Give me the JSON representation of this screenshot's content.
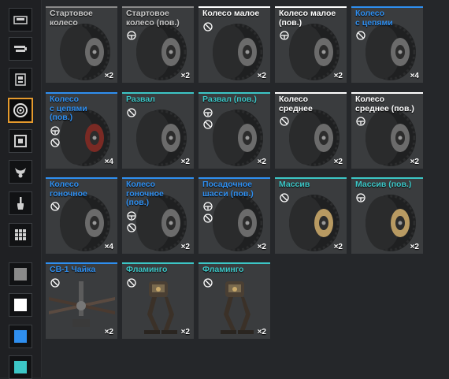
{
  "sidebar": {
    "categories": [
      {
        "icon": "cabin-icon",
        "active": false
      },
      {
        "icon": "weapons-icon",
        "active": false
      },
      {
        "icon": "modules-icon",
        "active": false
      },
      {
        "icon": "wheel-icon",
        "active": true
      },
      {
        "icon": "frame-icon",
        "active": false
      },
      {
        "icon": "decor-icon",
        "active": false
      },
      {
        "icon": "paint-brush-icon",
        "active": false
      },
      {
        "icon": "grid-icon",
        "active": false
      }
    ],
    "color_filters": [
      "#8a8a8a",
      "#ffffff",
      "#2f8ff0",
      "#3cc6c6"
    ]
  },
  "colors": {
    "common": "#8a8a8a",
    "rare": "#2f8ff0",
    "special": "#3cc6c6",
    "epic": "#ffffff"
  },
  "items": [
    {
      "name": "Стартовое колесо",
      "rarity": "common",
      "count": "×2",
      "perks": []
    },
    {
      "name": "Стартовое колесо (пов.)",
      "rarity": "common",
      "count": "×2",
      "perks": [
        "steer-icon"
      ]
    },
    {
      "name": "Колесо малое",
      "rarity": "epic",
      "count": "×2",
      "perks": [
        "no-steer-icon"
      ]
    },
    {
      "name": "Колесо малое (пов.)",
      "rarity": "epic",
      "count": "×2",
      "perks": [
        "steer-icon"
      ]
    },
    {
      "name": "Колесо с цепями",
      "rarity": "rare",
      "count": "×4",
      "perks": [
        "no-steer-icon"
      ]
    },
    {
      "name": "Колесо с цепями (пов.)",
      "rarity": "rare",
      "count": "×4",
      "perks": [
        "steer-icon",
        "no-steer-icon"
      ]
    },
    {
      "name": "Развал",
      "rarity": "special",
      "count": "×2",
      "perks": [
        "no-steer-icon"
      ]
    },
    {
      "name": "Развал (пов.)",
      "rarity": "special",
      "count": "×2",
      "perks": [
        "steer-icon",
        "no-steer-icon"
      ]
    },
    {
      "name": "Колесо среднее",
      "rarity": "epic",
      "count": "×2",
      "perks": [
        "no-steer-icon"
      ]
    },
    {
      "name": "Колесо среднее (пов.)",
      "rarity": "epic",
      "count": "×2",
      "perks": [
        "steer-icon"
      ]
    },
    {
      "name": "Колесо гоночное",
      "rarity": "rare",
      "count": "×4",
      "perks": [
        "no-steer-icon"
      ]
    },
    {
      "name": "Колесо гоночное (пов.)",
      "rarity": "rare",
      "count": "×2",
      "perks": [
        "steer-icon",
        "no-steer-icon"
      ]
    },
    {
      "name": "Посадочное шасси (пов.)",
      "rarity": "rare",
      "count": "×2",
      "perks": [
        "steer-icon",
        "no-steer-icon"
      ]
    },
    {
      "name": "Массив",
      "rarity": "special",
      "count": "×2",
      "perks": [
        "no-steer-icon"
      ]
    },
    {
      "name": "Массив (пов.)",
      "rarity": "special",
      "count": "×2",
      "perks": [
        "steer-icon"
      ]
    },
    {
      "name": "СВ-1 Чайка",
      "rarity": "rare",
      "count": "×2",
      "perks": [
        "no-steer-icon"
      ]
    },
    {
      "name": "Фламинго",
      "rarity": "special",
      "count": "×2",
      "perks": [
        "no-steer-icon"
      ]
    },
    {
      "name": "Фламинго",
      "rarity": "special",
      "count": "×2",
      "perks": [
        "no-steer-icon"
      ]
    }
  ]
}
